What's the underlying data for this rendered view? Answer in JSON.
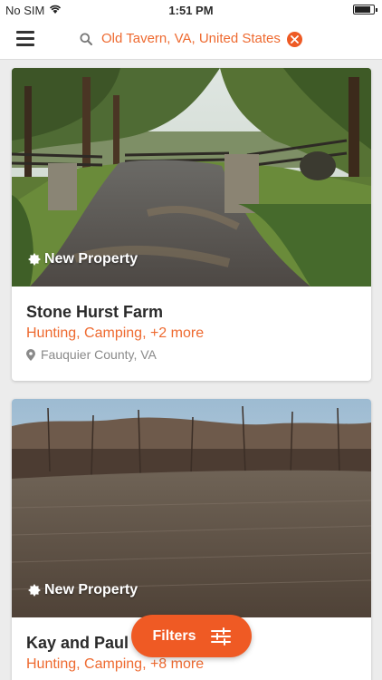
{
  "status_bar": {
    "carrier": "No SIM",
    "time": "1:51 PM",
    "battery_level": 0.85
  },
  "header": {
    "search_value": "Old Tavern, VA, United States",
    "icons": [
      "menu-icon",
      "search-icon",
      "clear-icon"
    ],
    "accent_color": "#ee6a30"
  },
  "listings": [
    {
      "badge": "New Property",
      "title": "Stone Hurst Farm",
      "activities": "Hunting, Camping, +2 more",
      "location": "Fauquier County, VA"
    },
    {
      "badge": "New Property",
      "title": "Kay and Paul",
      "activities": "Hunting, Camping, +8 more"
    }
  ],
  "filters_button": {
    "label": "Filters",
    "icon": "sliders-icon"
  }
}
